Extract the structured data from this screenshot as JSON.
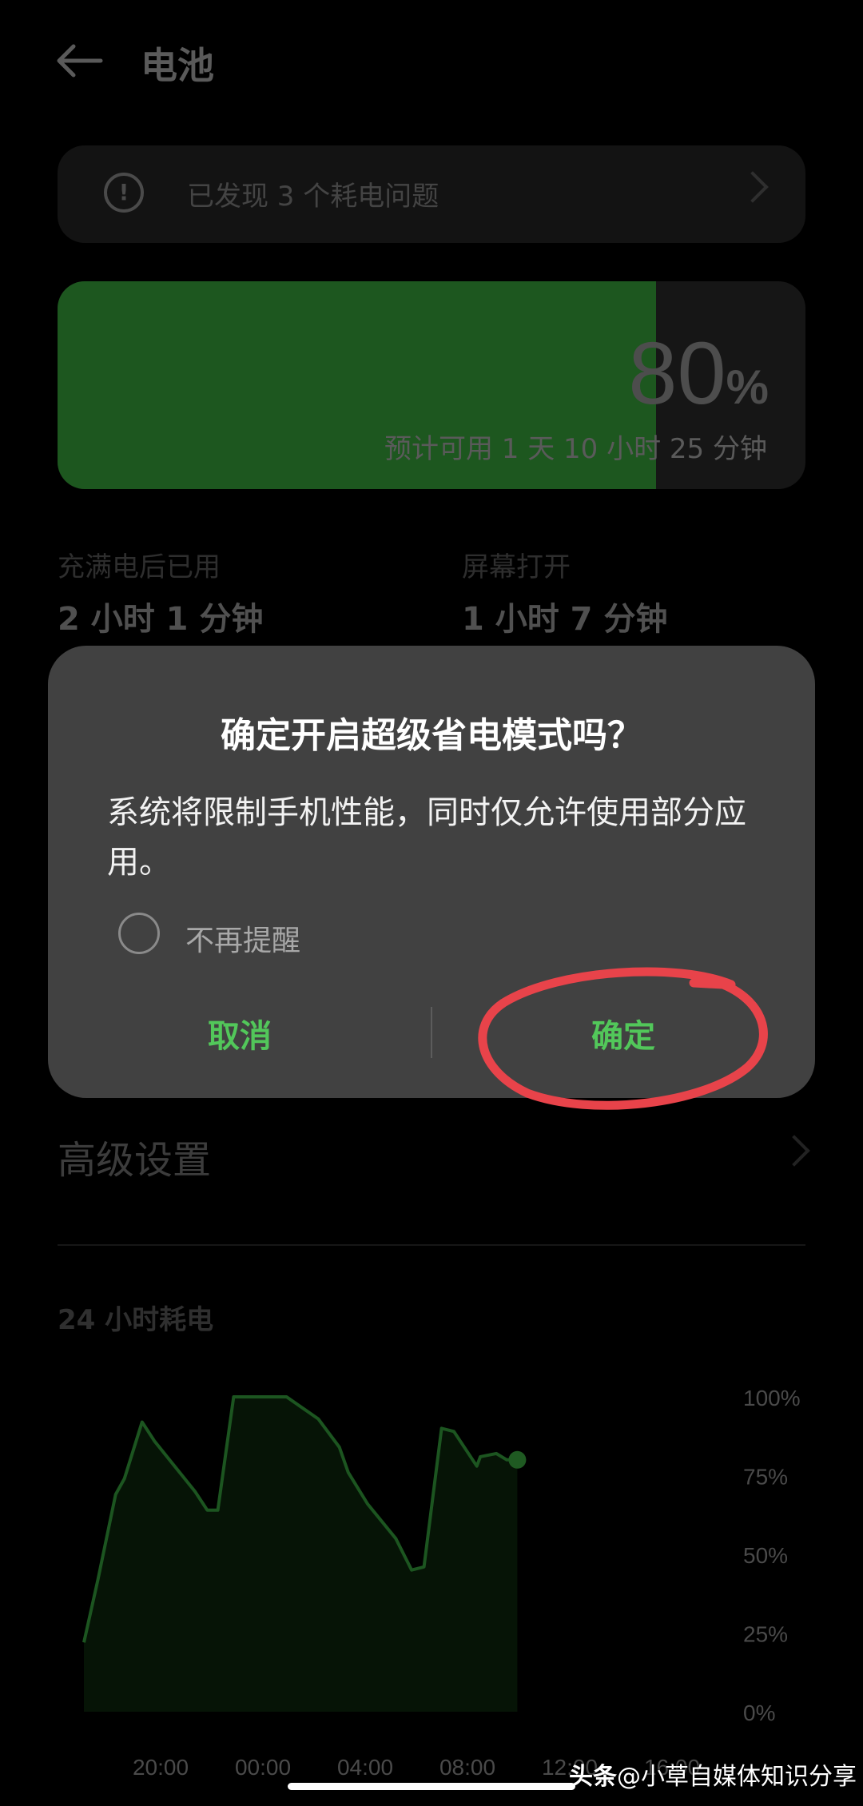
{
  "header": {
    "title": "电池"
  },
  "issues": {
    "text": "已发现 3 个耗电问题"
  },
  "battery": {
    "level_percent": 80,
    "percent_number": "80",
    "percent_unit": "%",
    "estimate": "预计可用 1 天 10 小时 25 分钟"
  },
  "stats": [
    {
      "label": "充满电后已用",
      "value": "2 小时 1 分钟"
    },
    {
      "label": "屏幕打开",
      "value": "1 小时 7 分钟"
    }
  ],
  "dialog": {
    "title": "确定开启超级省电模式吗？",
    "message": "系统将限制手机性能，同时仅允许使用部分应用。",
    "checkbox_label": "不再提醒",
    "cancel_label": "取消",
    "confirm_label": "确定"
  },
  "advanced": {
    "label": "高级设置"
  },
  "colors": {
    "accent": "#52c75a",
    "battery_fill": "#1d571f",
    "annotation_circle": "#e8434a"
  },
  "chart_data": {
    "type": "area",
    "title": "24 小时耗电",
    "x_ticks": [
      "20:00",
      "00:00",
      "04:00",
      "08:00",
      "12:00",
      "16:00"
    ],
    "y_ticks": [
      "100%",
      "75%",
      "50%",
      "25%",
      "0%"
    ],
    "ylim": [
      0,
      100
    ],
    "series": [
      {
        "x_hours": [
          0,
          0.8,
          1.8,
          2.3,
          3.3,
          4.0,
          5.0,
          6.3,
          7.0,
          7.6,
          8.5,
          9.6,
          11.5,
          13.3,
          14.5,
          15.0,
          16.1,
          17.7,
          18.6,
          19.3,
          20.3,
          21.0,
          22.3,
          22.5,
          23.4,
          24.0,
          24.6
        ],
        "values": [
          22,
          42,
          69,
          74,
          92,
          86,
          79,
          70,
          64,
          64,
          100,
          100,
          100,
          93,
          84,
          76,
          66,
          55,
          45,
          46,
          90,
          89,
          78,
          81,
          82,
          80,
          80
        ]
      }
    ],
    "grid": false,
    "legend": "none"
  },
  "watermark": {
    "brand": "头条",
    "handle": "@小草自媒体知识分享"
  }
}
